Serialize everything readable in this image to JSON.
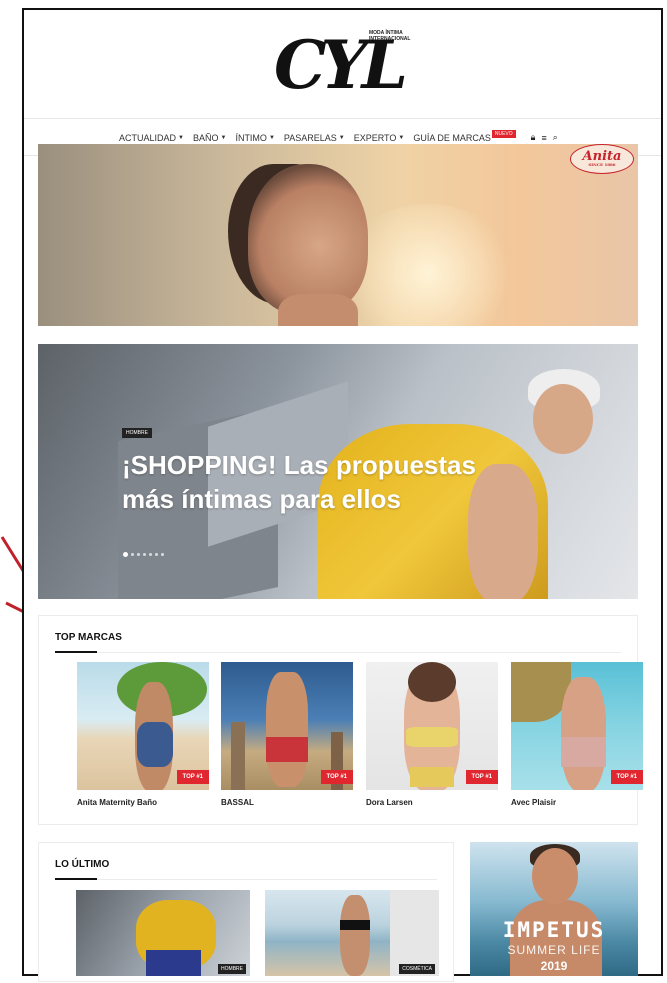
{
  "header": {
    "logo_text": "CYL",
    "logo_tagline": "MODA ÍNTIMA INTERNACIONAL"
  },
  "nav": {
    "items": [
      {
        "label": "ACTUALIDAD",
        "has_caret": true
      },
      {
        "label": "BAÑO",
        "has_caret": true
      },
      {
        "label": "ÍNTIMO",
        "has_caret": true
      },
      {
        "label": "PASARELAS",
        "has_caret": true
      },
      {
        "label": "EXPERTO",
        "has_caret": true
      },
      {
        "label": "GUÍA DE MARCAS",
        "has_caret": false,
        "badge": "NUEVO"
      }
    ],
    "icons": [
      "lock-icon",
      "menu-icon",
      "search-icon"
    ]
  },
  "hero_banner": {
    "brand_logo_text": "Anita",
    "brand_logo_sub": "SINCE 1886"
  },
  "slider": {
    "category": "HOMBRE",
    "title_line1": "¡SHOPPING! Las propuestas",
    "title_line2": "más íntimas para ellos",
    "slide_count": 7,
    "active_slide": 1
  },
  "top_marcas": {
    "title": "TOP MARCAS",
    "cards": [
      {
        "name": "Anita Maternity Baño",
        "badge": "TOP #1"
      },
      {
        "name": "BASSAL",
        "badge": "TOP #1"
      },
      {
        "name": "Dora Larsen",
        "badge": "TOP #1"
      },
      {
        "name": "Avec Plaisir",
        "badge": "TOP #1"
      }
    ]
  },
  "lo_ultimo": {
    "title": "LO ÚLTIMO",
    "thumbs": [
      {
        "tag": "HOMBRE"
      },
      {
        "tag": "COSMÉTICA"
      }
    ]
  },
  "ad": {
    "brand": "IMPETUS",
    "subtitle": "SUMMER LIFE",
    "year": "2019"
  },
  "colors": {
    "accent_red": "#e0262f",
    "text_dark": "#111111",
    "annotation_arrow": "#c0212a"
  }
}
